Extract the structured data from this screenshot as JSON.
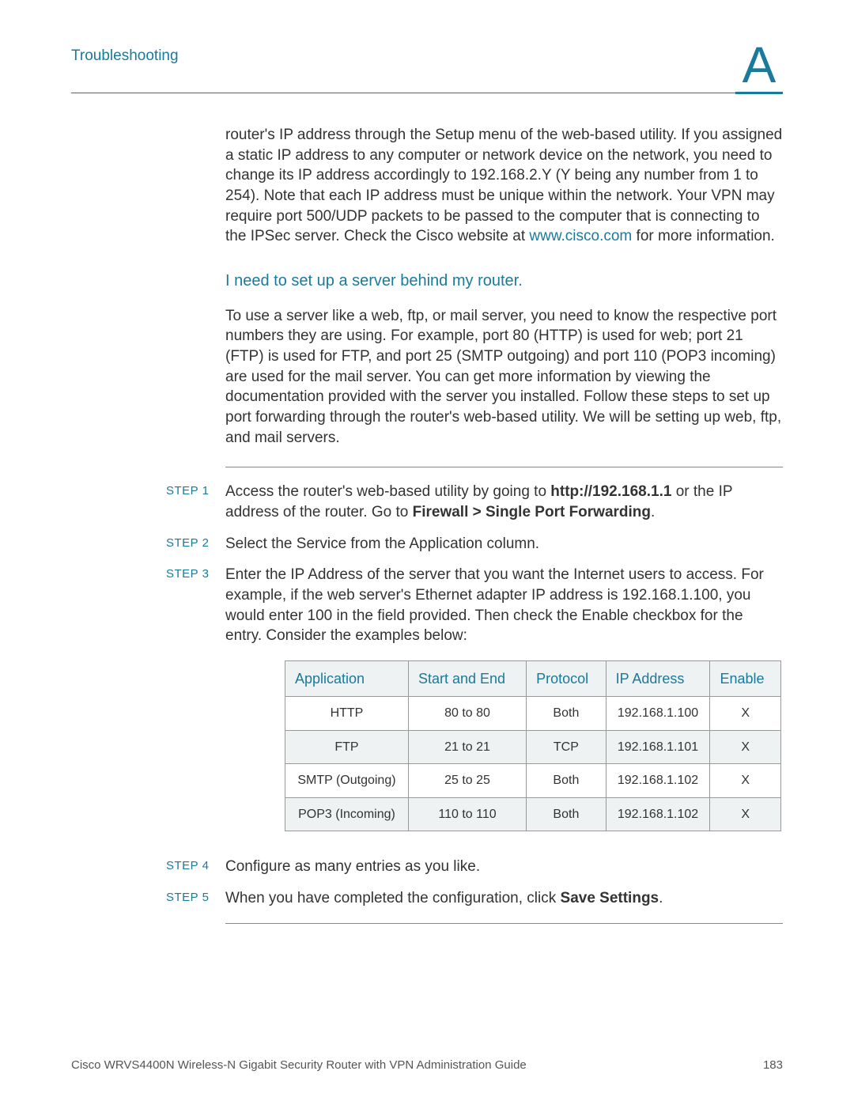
{
  "header": {
    "section": "Troubleshooting",
    "appendix_letter": "A"
  },
  "intro_para": {
    "prefix": "router's IP address through the Setup menu of the web-based utility. If you assigned a static IP address to any computer or network device on the network, you need to change its IP address accordingly to 192.168.2.Y (Y being any number from 1 to 254). Note that each IP address must be unique within the network. Your VPN may require port 500/UDP packets to be passed to the computer that is connecting to the IPSec server. Check the Cisco website at ",
    "link_text": "www.cisco.com",
    "suffix": " for more information."
  },
  "subhead": "I need to set up a server behind my router.",
  "body_para": "To use a server like a web, ftp, or mail server, you need to know the respective port numbers they are using. For example, port 80 (HTTP) is used for web; port 21 (FTP) is used for FTP, and port 25 (SMTP outgoing) and port 110 (POP3 incoming) are used for the mail server. You can get more information by viewing the documentation provided with the server you installed. Follow these steps to set up port forwarding through the router's web-based utility. We will be setting up web, ftp, and mail servers.",
  "steps": [
    {
      "label": "STEP 1",
      "text_pre": "Access the router's web-based utility by going to ",
      "bold1": "http://192.168.1.1",
      "mid": " or the IP address of the router. Go to ",
      "bold2": "Firewall > Single Port Forwarding",
      "post": "."
    },
    {
      "label": "STEP 2",
      "text": "Select the Service from the Application column."
    },
    {
      "label": "STEP 3",
      "text": "Enter the IP Address of the server that you want the Internet users to access. For example, if the web server's Ethernet adapter IP address is 192.168.1.100, you would enter 100 in the field provided. Then check the Enable checkbox for the entry. Consider the examples below:"
    },
    {
      "label": "STEP 4",
      "text": "Configure as many entries as you like."
    },
    {
      "label": "STEP 5",
      "text_pre": "When you have completed the configuration, click ",
      "bold1": "Save Settings",
      "post": "."
    }
  ],
  "table": {
    "headers": [
      "Application",
      "Start and End",
      "Protocol",
      "IP Address",
      "Enable"
    ],
    "rows": [
      [
        "HTTP",
        "80 to 80",
        "Both",
        "192.168.1.100",
        "X"
      ],
      [
        "FTP",
        "21 to 21",
        "TCP",
        "192.168.1.101",
        "X"
      ],
      [
        "SMTP (Outgoing)",
        "25 to 25",
        "Both",
        "192.168.1.102",
        "X"
      ],
      [
        "POP3 (Incoming)",
        "110 to 110",
        "Both",
        "192.168.1.102",
        "X"
      ]
    ]
  },
  "footer": {
    "title": "Cisco WRVS4400N Wireless-N Gigabit Security Router with VPN Administration Guide",
    "page": "183"
  }
}
